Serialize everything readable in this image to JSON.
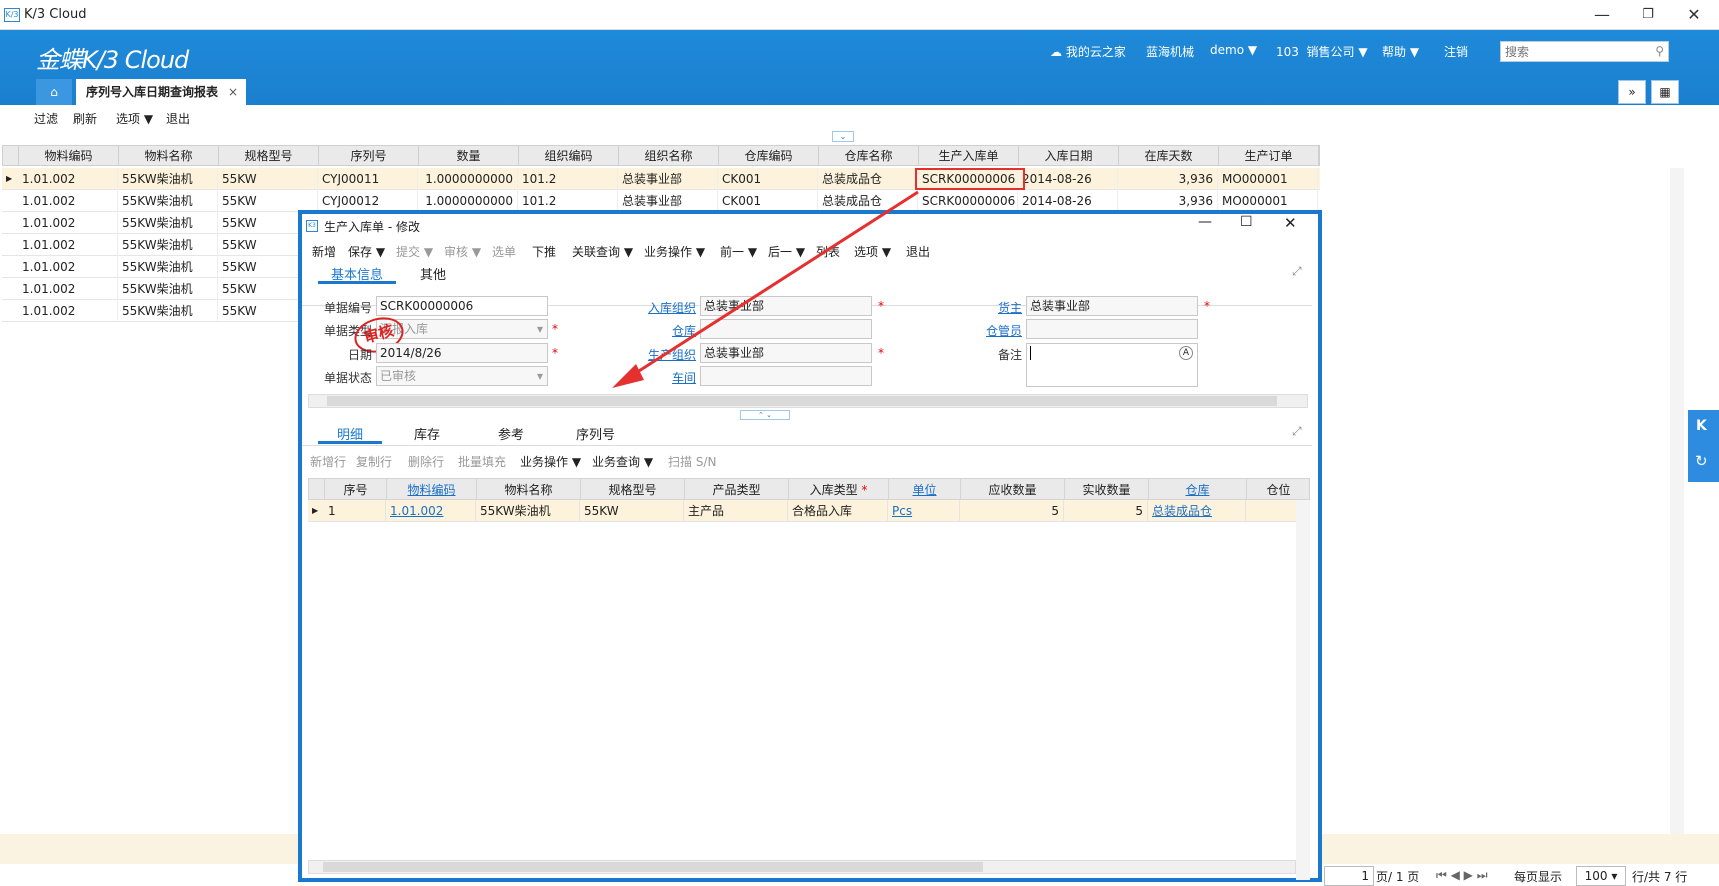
{
  "window": {
    "title": "K/3 Cloud",
    "logo": "K/3",
    "minimize": "—",
    "restore": "❐",
    "close": "✕"
  },
  "header": {
    "brand": "金蝶K/3 Cloud",
    "my_cloud": "我的云之家",
    "company": "蓝海机械",
    "user": "demo",
    "org_code": "103",
    "org_name": "销售公司",
    "help": "帮助",
    "logout": "注销",
    "search_placeholder": "搜索"
  },
  "tabs": {
    "active": "序列号入库日期查询报表",
    "close": "×"
  },
  "toolbar": {
    "filter": "过滤",
    "refresh": "刷新",
    "options": "选项",
    "exit": "退出"
  },
  "report": {
    "columns": [
      "物料编码",
      "物料名称",
      "规格型号",
      "序列号",
      "数量",
      "组织编码",
      "组织名称",
      "仓库编码",
      "仓库名称",
      "生产入库单",
      "入库日期",
      "在库天数",
      "生产订单"
    ],
    "rows": [
      [
        "1.01.002",
        "55KW柴油机",
        "55KW",
        "CYJ00011",
        "1.0000000000",
        "101.2",
        "总装事业部",
        "CK001",
        "总装成品仓",
        "SCRK00000006",
        "2014-08-26",
        "3,936",
        "MO000001"
      ],
      [
        "1.01.002",
        "55KW柴油机",
        "55KW",
        "CYJ00012",
        "1.0000000000",
        "101.2",
        "总装事业部",
        "CK001",
        "总装成品仓",
        "SCRK00000006",
        "2014-08-26",
        "3,936",
        "MO000001"
      ],
      [
        "1.01.002",
        "55KW柴油机",
        "55KW"
      ],
      [
        "1.01.002",
        "55KW柴油机",
        "55KW"
      ],
      [
        "1.01.002",
        "55KW柴油机",
        "55KW"
      ],
      [
        "1.01.002",
        "55KW柴油机",
        "55KW"
      ],
      [
        "1.01.002",
        "55KW柴油机",
        "55KW"
      ]
    ]
  },
  "pager": {
    "current": "1",
    "pages": "页/ 1 页",
    "per_page_label": "每页显示",
    "per_page": "100",
    "total": "行/共 7 行"
  },
  "modal": {
    "title": "生产入库单 - 修改",
    "toolbar": [
      "新增",
      "保存",
      "提交",
      "审核",
      "选单",
      "下推",
      "关联查询",
      "业务操作",
      "前一",
      "后一",
      "列表",
      "选项",
      "退出"
    ],
    "tabs": [
      "基本信息",
      "其他"
    ],
    "fields": {
      "bill_no_label": "单据编号",
      "bill_no": "SCRK00000006",
      "bill_type_label": "单据类型",
      "bill_type": "汇报入库",
      "date_label": "日期",
      "date": "2014/8/26",
      "status_label": "单据状态",
      "status": "已审核",
      "stock_org_label": "入库组织",
      "stock_org": "总装事业部",
      "warehouse_label": "仓库",
      "warehouse": "",
      "prd_org_label": "生产组织",
      "prd_org": "总装事业部",
      "workshop_label": "车间",
      "workshop": "",
      "owner_label": "货主",
      "owner": "总装事业部",
      "keeper_label": "仓管员",
      "keeper": "",
      "note_label": "备注",
      "note": ""
    },
    "stamp": "审核",
    "detail_tabs": [
      "明细",
      "库存",
      "参考",
      "序列号"
    ],
    "detail_toolbar": [
      "新增行",
      "复制行",
      "删除行",
      "批量填充",
      "业务操作",
      "业务查询",
      "扫描 S/N"
    ],
    "detail_columns": [
      "序号",
      "物料编码",
      "物料名称",
      "规格型号",
      "产品类型",
      "入库类型",
      "单位",
      "应收数量",
      "实收数量",
      "仓库",
      "仓位"
    ],
    "detail_rows": [
      [
        "1",
        "1.01.002",
        "55KW柴油机",
        "55KW",
        "主产品",
        "合格品入库",
        "Pcs",
        "5",
        "5",
        "总装成品仓",
        ""
      ]
    ]
  }
}
